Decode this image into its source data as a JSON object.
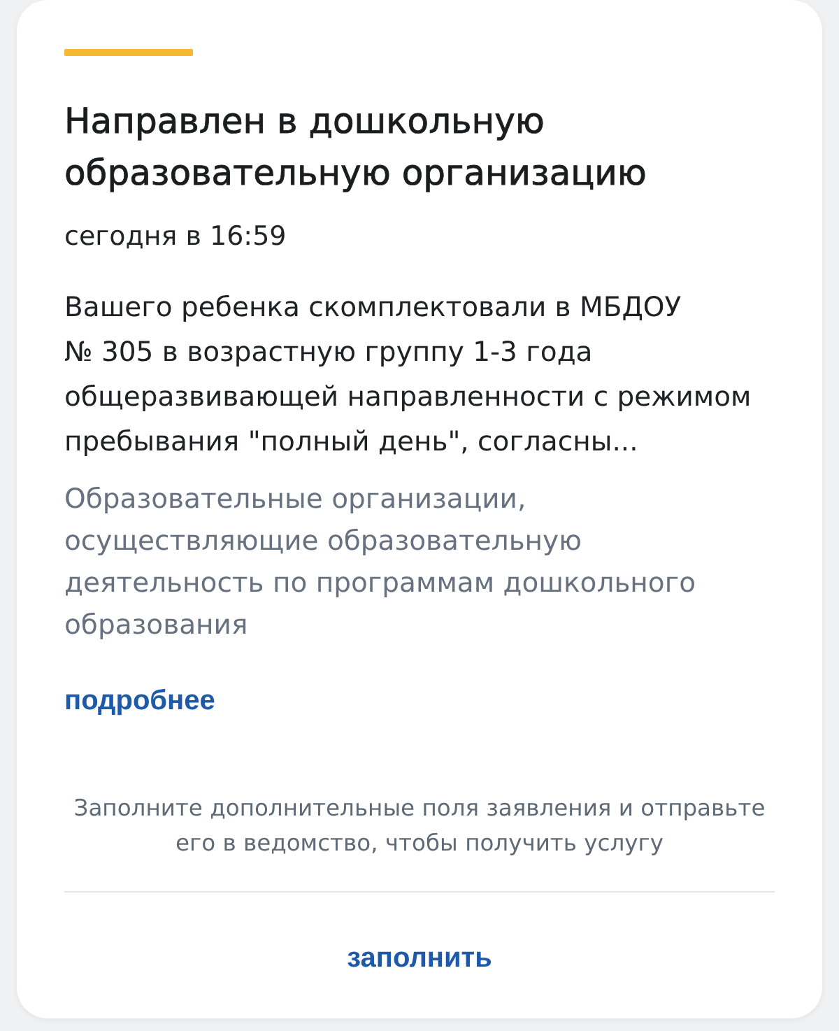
{
  "card": {
    "title": "Направлен в дошкольную образовательную организацию",
    "time": "сегодня в 16:59",
    "message": "Вашего ребенка скомплектовали в МБДОУ № 305 в возрастную группу 1-3 года общеразвивающей направленности с режимом пребывания \"полный день\", согласны...",
    "category": "Образовательные организации, осуществляющие образовательную деятельность по программам дошкольного образования",
    "details_link": "подробнее",
    "note": "Заполните дополнительные поля заявления и отправьте его в ведомство, чтобы получить услугу",
    "action_button": "заполнить"
  }
}
